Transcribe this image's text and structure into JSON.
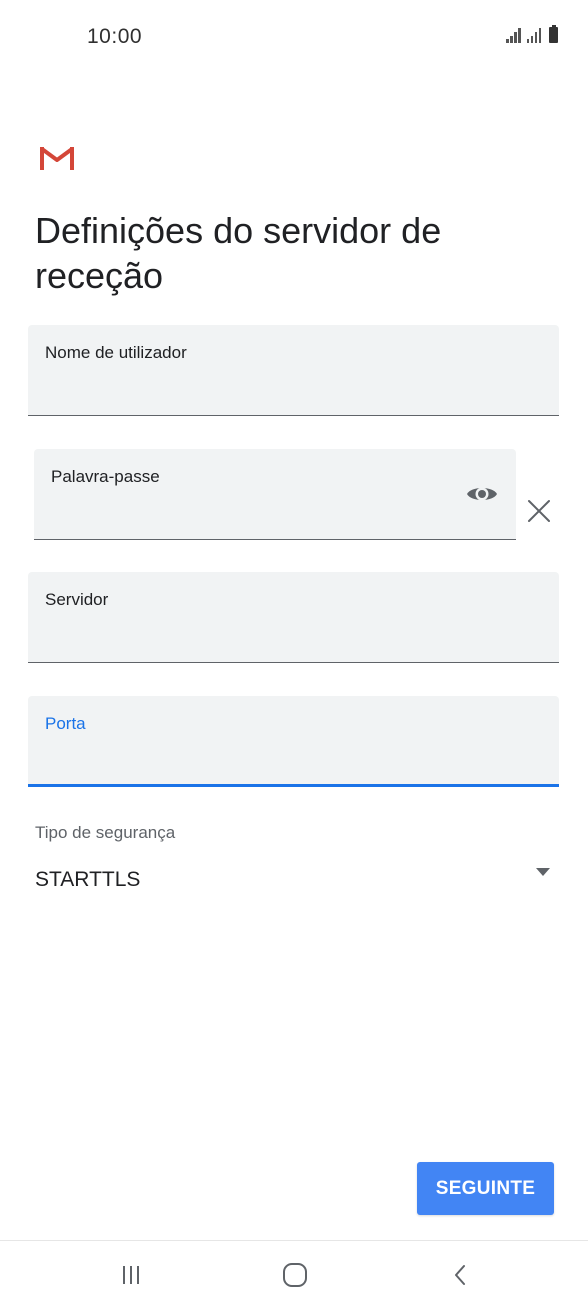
{
  "status_bar": {
    "time": "10:00"
  },
  "app": {
    "logo_icon": "gmail-icon",
    "colors": {
      "gmail_red": "#d44638",
      "accent_blue": "#1a73e8",
      "button_blue": "#4285f4",
      "field_bg": "#f1f3f4"
    }
  },
  "page": {
    "title": "Definições do servidor de receção"
  },
  "form": {
    "username": {
      "label": "Nome de utilizador",
      "value": ""
    },
    "password": {
      "label": "Palavra-passe",
      "value": "",
      "show_icon": "eye-icon",
      "clear_icon": "close-icon"
    },
    "server": {
      "label": "Servidor",
      "value": ""
    },
    "port": {
      "label": "Porta",
      "value": "",
      "focused": true
    },
    "security": {
      "label": "Tipo de segurança",
      "value": "STARTTLS"
    }
  },
  "actions": {
    "next_label": "SEGUINTE"
  },
  "nav": {
    "recents_icon": "recents-icon",
    "home_icon": "home-icon",
    "back_icon": "back-icon"
  }
}
